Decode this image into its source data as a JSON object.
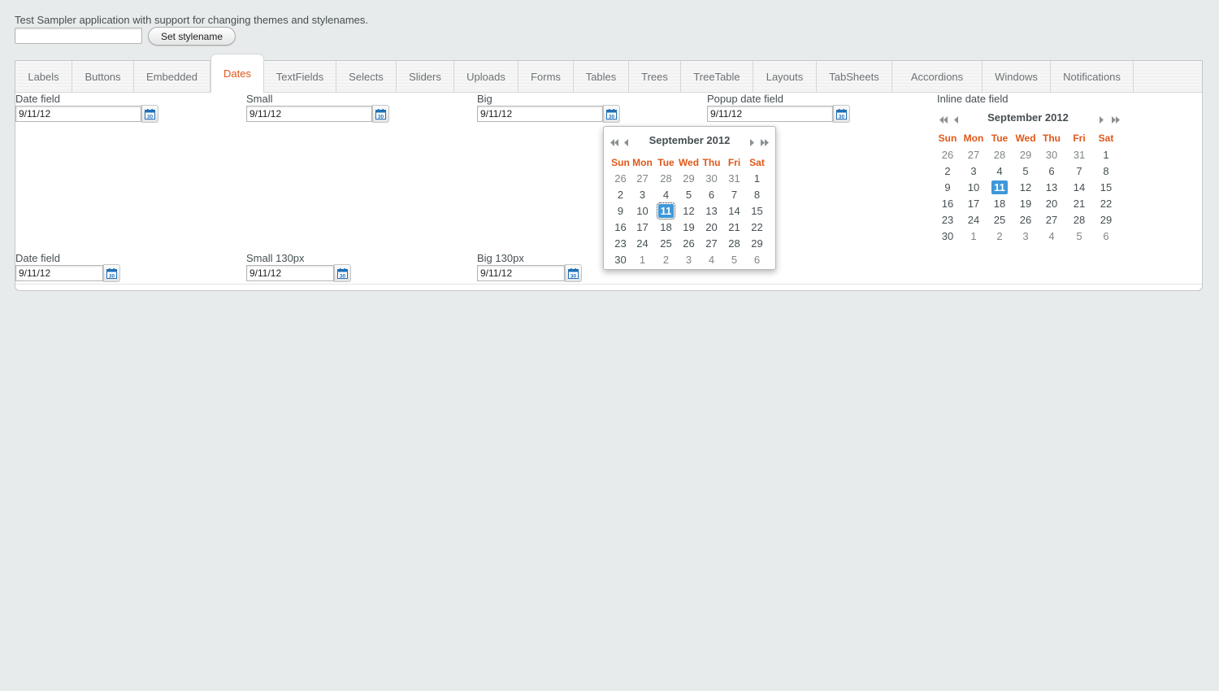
{
  "header": {
    "description": "Test Sampler application with support for changing themes and stylenames.",
    "stylename_value": "",
    "set_stylename_label": "Set stylename"
  },
  "tabs": [
    {
      "label": "Labels",
      "selected": false
    },
    {
      "label": "Buttons",
      "selected": false
    },
    {
      "label": "Embedded",
      "selected": false
    },
    {
      "label": "Dates",
      "selected": true
    },
    {
      "label": "TextFields",
      "selected": false
    },
    {
      "label": "Selects",
      "selected": false
    },
    {
      "label": "Sliders",
      "selected": false
    },
    {
      "label": "Uploads",
      "selected": false
    },
    {
      "label": "Forms",
      "selected": false
    },
    {
      "label": "Tables",
      "selected": false
    },
    {
      "label": "Trees",
      "selected": false
    },
    {
      "label": "TreeTable",
      "selected": false
    },
    {
      "label": "Layouts",
      "selected": false
    },
    {
      "label": "TabSheets",
      "selected": false
    },
    {
      "label": "Accordions",
      "selected": false
    },
    {
      "label": "Windows",
      "selected": false
    },
    {
      "label": "Notifications",
      "selected": false
    }
  ],
  "fields": {
    "date_field": {
      "label": "Date field",
      "value": "9/11/12"
    },
    "small": {
      "label": "Small",
      "value": "9/11/12"
    },
    "big": {
      "label": "Big",
      "value": "9/11/12"
    },
    "popup_date_field": {
      "label": "Popup date field",
      "value": "9/11/12"
    },
    "inline_date_field": {
      "label": "Inline date field"
    },
    "date_field_2": {
      "label": "Date field",
      "value": "9/11/12"
    },
    "small_130": {
      "label": "Small 130px",
      "value": "9/11/12"
    },
    "big_130": {
      "label": "Big 130px",
      "value": "9/11/12"
    }
  },
  "calendar": {
    "month_title": "September 2012",
    "weekdays": [
      "Sun",
      "Mon",
      "Tue",
      "Wed",
      "Thu",
      "Fri",
      "Sat"
    ],
    "weeks": [
      [
        "26",
        "27",
        "28",
        "29",
        "30",
        "31",
        "1"
      ],
      [
        "2",
        "3",
        "4",
        "5",
        "6",
        "7",
        "8"
      ],
      [
        "9",
        "10",
        "11",
        "12",
        "13",
        "14",
        "15"
      ],
      [
        "16",
        "17",
        "18",
        "19",
        "20",
        "21",
        "22"
      ],
      [
        "23",
        "24",
        "25",
        "26",
        "27",
        "28",
        "29"
      ],
      [
        "30",
        "1",
        "2",
        "3",
        "4",
        "5",
        "6"
      ]
    ],
    "selected_day": "11",
    "icon_label": "30"
  },
  "colors": {
    "accent": "#e0571a",
    "selected_day": "#3e98d9",
    "calendar_icon": "#1e6fb8"
  }
}
